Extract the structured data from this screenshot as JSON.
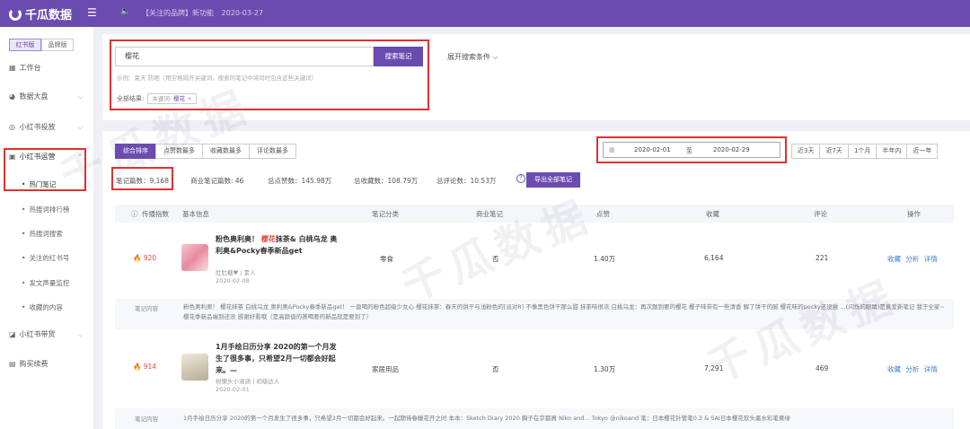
{
  "brand": {
    "name": "千瓜数据"
  },
  "notice": {
    "tag": "【关注的品牌】新功能",
    "date": "2020-03-27"
  },
  "sidebar": {
    "switch": [
      "红书版",
      "品牌版"
    ],
    "items": [
      {
        "label": "工作台"
      },
      {
        "label": "数据大盘"
      },
      {
        "label": "小红书投放"
      },
      {
        "label": "小红书运营"
      },
      {
        "label": "小红书带货"
      },
      {
        "label": "购买续费"
      }
    ],
    "sub_items": [
      "热门笔记",
      "热搜词排行榜",
      "热搜词搜索",
      "关注的红书号",
      "发文声量监控",
      "收藏的内容"
    ]
  },
  "search": {
    "value": "樱花",
    "button": "搜索笔记",
    "hint": "示例：夏天 防晒（用空格隔开关键词，搜索的笔记中将同时包含这些关键词）",
    "result_label": "全部结果:",
    "tag_prefix": "关键词:",
    "tag_value": "樱花",
    "expand": "展开搜索条件"
  },
  "sort_tabs": [
    "综合排序",
    "点赞数最多",
    "收藏数最多",
    "评论数最多"
  ],
  "date_range": {
    "start": "2020-02-01",
    "sep": "至",
    "end": "2020-02-29"
  },
  "quick_ranges": [
    "近3天",
    "近7天",
    "1个月",
    "半年内",
    "近一年"
  ],
  "stats": {
    "notes": "笔记篇数：9,168",
    "commercial": "商业笔记篇数: 46",
    "likes": "总点赞数：145.98万",
    "favorites": "总收藏数：108.79万",
    "comments": "总评论数：10.53万",
    "export": "导出全部笔记"
  },
  "table": {
    "headers": [
      "传播指数",
      "基本信息",
      "笔记分类",
      "商业笔记",
      "点赞",
      "收藏",
      "评论",
      "操作"
    ],
    "rows": [
      {
        "index": "920",
        "title_parts": [
          "粉色奥利奥！",
          "樱花",
          "抹茶&",
          "白桃乌龙",
          "奥利奥&Pocky春季新品get"
        ],
        "author": "肚肚糖♥ | 素人",
        "date": "2020-02-08",
        "category": "零食",
        "commercial": "否",
        "likes": "1.40万",
        "favorites": "6,164",
        "comments": "221",
        "ops": "收藏 分析 详情",
        "content_label": "笔记内容",
        "content": "粉色奥利奥！ 樱花抹茶 白桃乌龙 奥利奥&Pocky春季新品get！ 一直喝的粉色超级少女心 樱花抹茶：春天的饼干与浅粉色的[派对R] 不像黑色饼干那么甜 抹茶味很浓 白桃乌龙：再次题到要的樱花 樱子味带有一些清香 解了饼干的腻 樱花味的pocky还没尝 …(闪烁的眼睛)是真爱新笔记 我于全家~ 樱花季新品端到还没 感谢好看哦（是高颜值的蒸喝要的新品就是要到了）"
      },
      {
        "index": "914",
        "title_parts": [
          "1月手绘日历分享",
          "2020的第一个月发生了很多事，只希望2月一切都会好起来。—"
        ],
        "author": "树懒头小涵涵 | 初级达人",
        "date": "2020-02-01",
        "category": "家居用品",
        "commercial": "否",
        "likes": "1.30万",
        "favorites": "7,291",
        "comments": "469",
        "ops": "收藏 分析 详情",
        "content_label": "笔记内容",
        "content": "1月手绘日历分享 2020的第一个月发生了很多事，只希望2月一切都会好起来。一起期待春暖花开之时 本本：Sketch Diary 2020 胸子在京都買 Niko and... Tokyo @nikoand 笔：日本樱花针管笔0.3 & SAI日本樱花软头墨水彩笔黄绿"
      }
    ]
  },
  "watermark": "千瓜数据",
  "colors": {
    "accent": "#6a4bb0",
    "highlight": "#e03030",
    "link": "#3a7bd5"
  }
}
